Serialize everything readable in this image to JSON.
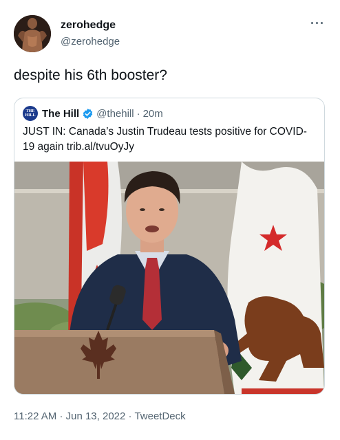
{
  "author": {
    "name": "zerohedge",
    "handle": "@zerohedge"
  },
  "tweet": {
    "text": "despite his 6th booster?"
  },
  "quoted": {
    "logo_text": "THE HILL",
    "name": "The Hill",
    "handle": "@thehill",
    "separator": "·",
    "time": "20m",
    "text": "JUST IN: Canada’s Justin Trudeau tests positive for COVID-19 again",
    "link": "trib.al/tvuOyJy",
    "image_icons": [
      "canada-flag",
      "california-flag",
      "podium-maple-leaf",
      "microphone"
    ]
  },
  "footer": {
    "time": "11:22 AM",
    "sep1": "·",
    "date": "Jun 13, 2022",
    "sep2": "·",
    "source": "TweetDeck"
  },
  "colors": {
    "text": "#0f1419",
    "secondary": "#536471",
    "border": "#cfd9de",
    "verified": "#1d9bf0"
  }
}
